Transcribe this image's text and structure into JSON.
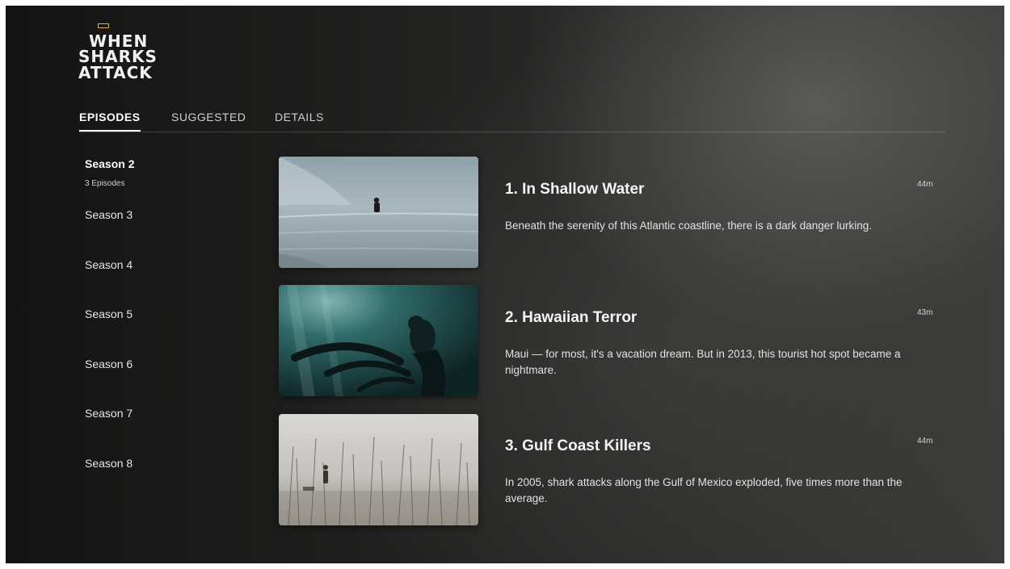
{
  "show": {
    "logo_lines": [
      "WHEN",
      "SHARKS",
      "ATTACK"
    ]
  },
  "tabs": [
    {
      "label": "EPISODES",
      "active": true
    },
    {
      "label": "SUGGESTED",
      "active": false
    },
    {
      "label": "DETAILS",
      "active": false
    }
  ],
  "seasons": {
    "selected": {
      "label": "Season 2",
      "episode_count": "3 Episodes"
    },
    "others": [
      "Season 3",
      "Season 4",
      "Season 5",
      "Season 6",
      "Season 7",
      "Season 8"
    ]
  },
  "episodes": [
    {
      "title": "1. In Shallow Water",
      "duration": "44m",
      "description": "Beneath the serenity of this Atlantic coastline, there is a dark danger lurking."
    },
    {
      "title": "2. Hawaiian Terror",
      "duration": "43m",
      "description": "Maui — for most, it's a vacation dream. But in 2013, this tourist hot spot became a nightmare."
    },
    {
      "title": "3. Gulf Coast Killers",
      "duration": "44m",
      "description": "In 2005, shark attacks along the Gulf of Mexico exploded, five times more than the average."
    }
  ]
}
